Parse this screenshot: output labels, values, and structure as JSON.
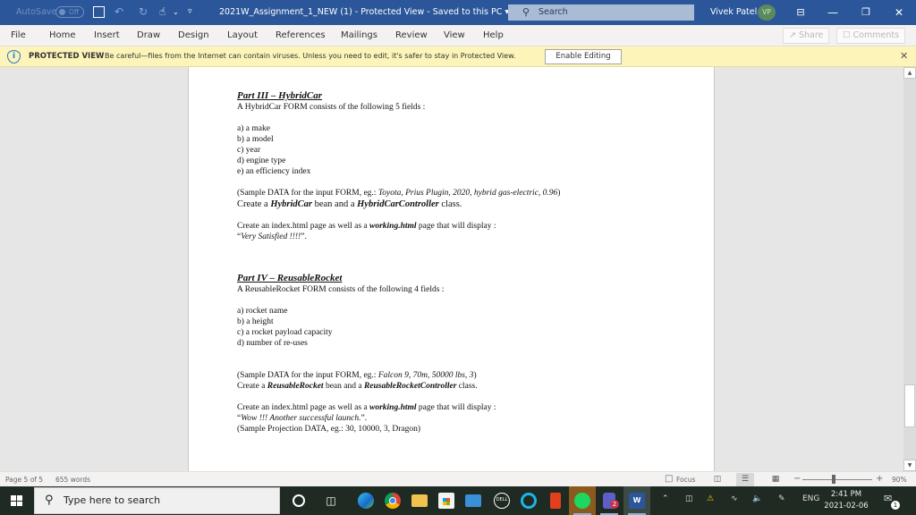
{
  "titlebar": {
    "autosave_label": "AutoSave",
    "autosave_state": "Off",
    "document_title": "2021W_Assignment_1_NEW (1)  -  Protected View  -  Saved to this PC  ▾",
    "search_placeholder": "Search",
    "user_name": "Vivek Patel",
    "user_initials": "VP",
    "icons": {
      "save": "🖫",
      "undo": "↶",
      "redo": "↻",
      "touch": "☝",
      "more": "▿",
      "ribbon": "⊟",
      "minimize": "—",
      "restore": "❐",
      "close": "✕"
    }
  },
  "menubar": {
    "items": [
      "File",
      "Home",
      "Insert",
      "Draw",
      "Design",
      "Layout",
      "References",
      "Mailings",
      "Review",
      "View",
      "Help"
    ],
    "share_label": "↗ Share",
    "comments_label": "☐ Comments"
  },
  "protected_view": {
    "label": "PROTECTED VIEW",
    "message": "Be careful—files from the Internet can contain viruses. Unless you need to edit, it's safer to stay in Protected View.",
    "enable_button": "Enable Editing",
    "close_icon": "✕",
    "info_icon": "i"
  },
  "document": {
    "part3": {
      "heading": "Part III – HybridCar",
      "intro": "A HybridCar FORM consists of the following 5 fields :",
      "fields": [
        "a) a make",
        "b) a model",
        "c) year",
        "d) engine type",
        "e) an efficiency index"
      ],
      "sample_prefix": "(Sample DATA for the input FORM, eg.: ",
      "sample_values": "Toyota, Prius Plugin, 2020, hybrid gas-electric, 0.96",
      "sample_suffix": ")",
      "create_prefix": "Create a ",
      "bean": "HybridCar",
      "create_mid": " bean and a ",
      "controller": "HybridCarController",
      "create_suffix": " class.",
      "page_prefix": "Create an index.html page as well as a ",
      "page_name": "working.html",
      "page_suffix": " page that will display :",
      "display_open": "“",
      "display_text": "Very Satisfied !!!!",
      "display_close": "”."
    },
    "part4": {
      "heading": "Part IV – ReusableRocket",
      "intro": "A ReusableRocket FORM consists of the following 4 fields :",
      "fields": [
        "a) rocket name",
        "b) a height",
        "c) a rocket payload capacity",
        "d) number of re-uses"
      ],
      "sample_prefix": "(Sample DATA for the input FORM, eg.: ",
      "sample_values": "Falcon 9, 70m, 50000 lbs, 3",
      "sample_suffix": ")",
      "create_prefix": "Create a ",
      "bean": "ReusableRocket",
      "create_mid": " bean and a ",
      "controller": "ReusableRocketController",
      "create_suffix": " class.",
      "page_prefix": "Create an index.html page as well as a ",
      "page_name": "working.html",
      "page_suffix": " page that will display :",
      "display_open": "“",
      "display_text": "Wow !!! Another successful launch.",
      "display_close": "”.",
      "projection": "(Sample Projection DATA, eg.: 30, 10000, 3, Dragon)"
    }
  },
  "statusbar": {
    "page": "Page 5 of 5",
    "words": "655 words",
    "focus": "Focus",
    "zoom_minus": "−",
    "zoom_plus": "+",
    "zoom_level": "90%",
    "zoom_fraction": 0.45
  },
  "taskbar": {
    "search_placeholder": "Type here to search",
    "apps": [
      {
        "name": "cortana",
        "color": "#1f2a22",
        "ring": "#ffffff"
      },
      {
        "name": "task-view",
        "color": "#1f2a22"
      },
      {
        "name": "edge",
        "color": "#1d8fd8"
      },
      {
        "name": "chrome",
        "color": "#e2b33a"
      },
      {
        "name": "file-explorer",
        "color": "#f0c34e"
      },
      {
        "name": "store",
        "color": "#f3f3f3"
      },
      {
        "name": "mail",
        "color": "#3a8fd9"
      },
      {
        "name": "dell",
        "color": "#1f2a22"
      },
      {
        "name": "alexa",
        "color": "#1fb3e8"
      },
      {
        "name": "office",
        "color": "#e2401c"
      },
      {
        "name": "spotify",
        "color": "#1ed760"
      },
      {
        "name": "teams",
        "color": "#5b5fc7"
      },
      {
        "name": "word",
        "color": "#2b579a"
      }
    ],
    "teams_badge": "2",
    "language": "ENG",
    "time": "2:41 PM",
    "date": "2021-02-06",
    "notification_count": "1"
  }
}
